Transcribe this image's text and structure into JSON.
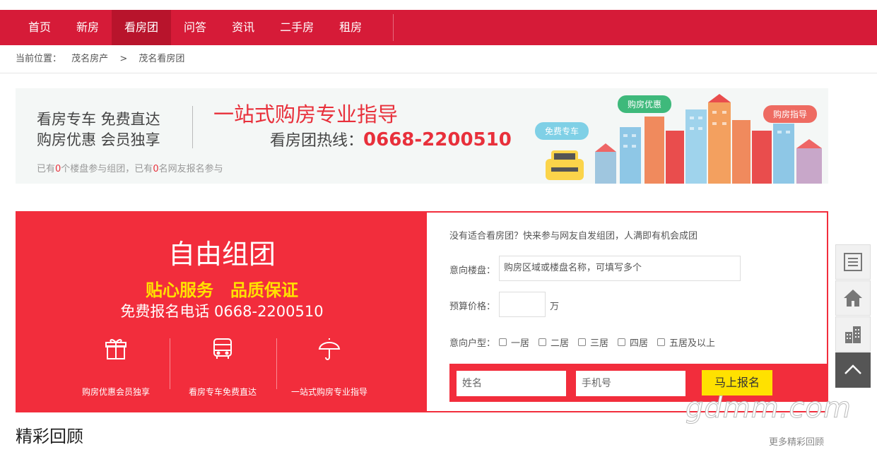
{
  "nav": {
    "items": [
      {
        "label": "首页"
      },
      {
        "label": "新房"
      },
      {
        "label": "看房团"
      },
      {
        "label": "问答"
      },
      {
        "label": "资讯"
      },
      {
        "label": "二手房"
      },
      {
        "label": "租房"
      }
    ],
    "active": "看房团"
  },
  "breadcrumb": {
    "prefix": "当前位置：",
    "items": [
      "茂名房产",
      "茂名看房团"
    ],
    "separator": ">"
  },
  "banner": {
    "line1": "看房专车 免费直达",
    "line2": "购房优惠 会员独享",
    "slogan": "一站式购房专业指导",
    "hotline_label": "看房团热线：",
    "hotline_number": "0668-2200510",
    "stats_a": "已有",
    "stats_count1": "0",
    "stats_b": "个楼盘参与组团，已有",
    "stats_count2": "0",
    "stats_c": "名网友报名参与",
    "bubble_free_car": "免费专车",
    "bubble_discount": "购房优惠",
    "bubble_guide": "购房指导"
  },
  "signup": {
    "title": "自由组团",
    "sub1": "贴心服务",
    "sub2": "品质保证",
    "phone": "免费报名电话 0668-2200510",
    "features": [
      {
        "label": "购房优惠会员独享",
        "icon": "gift-icon"
      },
      {
        "label": "看房专车免费直达",
        "icon": "bus-icon"
      },
      {
        "label": "一站式购房专业指导",
        "icon": "umbrella-icon"
      }
    ],
    "form": {
      "intro": "没有适合看房团？快来参与网友自发组团，人满即有机会成团",
      "estate_label": "意向楼盘：",
      "estate_placeholder": "购房区域或楼盘名称，可填写多个",
      "budget_label": "预算价格：",
      "budget_value": "",
      "budget_unit": "万",
      "layout_label": "意向户型：",
      "layout_options": [
        "一居",
        "二居",
        "三居",
        "四居",
        "五居及以上"
      ],
      "name_placeholder": "姓名",
      "phone_placeholder": "手机号",
      "submit_label": "马上报名"
    }
  },
  "review": {
    "title": "精彩回顾",
    "more": "更多精彩回顾"
  },
  "watermark": "gdmm.com",
  "sidebar_tools": [
    "list-icon",
    "home-icon",
    "building-icon",
    "back-to-top-icon"
  ],
  "colors": {
    "nav_red": "#d61b38",
    "panel_red": "#f22d3c",
    "accent_yellow": "#ffe100",
    "bubble_green": "#3eb97b",
    "bubble_blue": "#7fd0e6",
    "bubble_salmon": "#ee6b62"
  }
}
